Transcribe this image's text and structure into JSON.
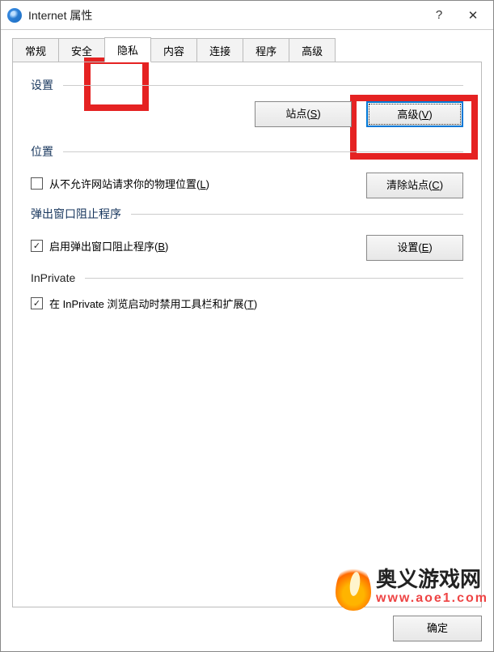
{
  "window": {
    "title": "Internet 属性",
    "help": "?",
    "close": "✕"
  },
  "tabs": [
    "常规",
    "安全",
    "隐私",
    "内容",
    "连接",
    "程序",
    "高级"
  ],
  "activeTab": 2,
  "sections": {
    "settings": {
      "label": "设置",
      "site_btn": "站点(S)",
      "advanced_btn": "高级(V)"
    },
    "location": {
      "label": "位置",
      "deny_label": "从不允许网站请求你的物理位置(L)",
      "deny_checked": false,
      "clear_btn": "清除站点(C)"
    },
    "popup": {
      "label": "弹出窗口阻止程序",
      "enable_label": "启用弹出窗口阻止程序(B)",
      "enable_checked": true,
      "settings_btn": "设置(E)"
    },
    "inprivate": {
      "label": "InPrivate",
      "disable_ext_label": "在 InPrivate 浏览启动时禁用工具栏和扩展(T)",
      "disable_ext_checked": true
    }
  },
  "footer": {
    "ok": "确定"
  },
  "watermark": {
    "cn": "奥义游戏网",
    "en": "www.aoe1.com"
  }
}
